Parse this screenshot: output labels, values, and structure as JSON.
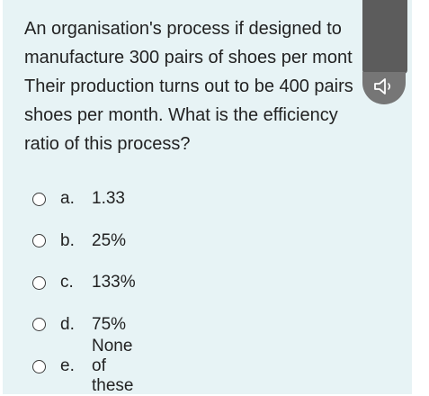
{
  "question": {
    "text": "An organisation's process if designed to\nmanufacture 300 pairs of shoes per mont\nTheir production turns out to be 400 pairs\nshoes per month. What is the efficiency\nratio of this process?"
  },
  "options": [
    {
      "letter": "a.",
      "text": "1.33"
    },
    {
      "letter": "b.",
      "text": "25%"
    },
    {
      "letter": "c.",
      "text": "133%"
    },
    {
      "letter": "d.",
      "text": "75%"
    },
    {
      "letter": "e.",
      "text": "None of these"
    }
  ],
  "overlay": {
    "icon": "speaker-icon"
  },
  "colors": {
    "card_background": "#e7f3f5",
    "text": "#222222",
    "overlay_dark": "#5c5c5c",
    "overlay_button": "#767676"
  }
}
